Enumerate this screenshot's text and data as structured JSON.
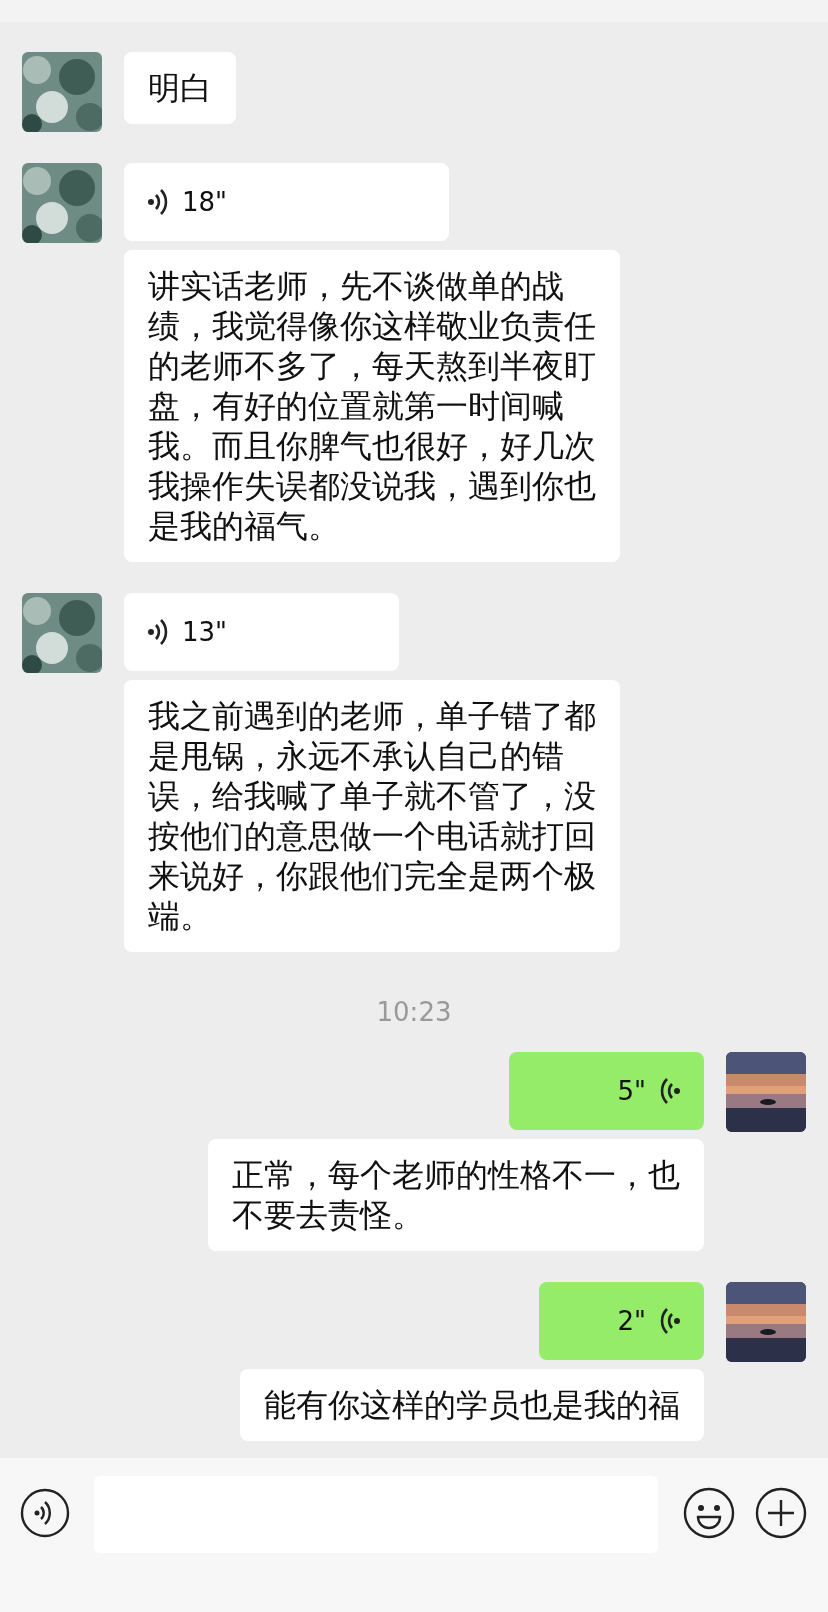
{
  "items": [
    {
      "kind": "group",
      "outgoing": false,
      "bubbles": [
        {
          "kind": "text",
          "lines": [
            "明白"
          ]
        }
      ]
    },
    {
      "kind": "group",
      "outgoing": false,
      "bubbles": [
        {
          "kind": "voice",
          "duration": "18\""
        },
        {
          "kind": "text",
          "lines": [
            "讲实话老师，先不谈做单的战",
            "绩，我觉得像你这样敬业负责任",
            "的老师不多了，每天熬到半夜盯",
            "盘，有好的位置就第一时间喊",
            "我。而且你脾气也很好，好几次",
            "我操作失误都没说我，遇到你也",
            "是我的福气。"
          ]
        }
      ]
    },
    {
      "kind": "group",
      "outgoing": false,
      "bubbles": [
        {
          "kind": "voice",
          "duration": "13\""
        },
        {
          "kind": "text",
          "lines": [
            "我之前遇到的老师，单子错了都",
            "是甩锅，永远不承认自己的错",
            "误，给我喊了单子就不管了，没",
            "按他们的意思做一个电话就打回",
            "来说好，你跟他们完全是两个极",
            "端。"
          ]
        }
      ]
    },
    {
      "kind": "time",
      "text": "10:23"
    },
    {
      "kind": "group",
      "outgoing": true,
      "bubbles": [
        {
          "kind": "voice",
          "duration": "5\""
        },
        {
          "kind": "text",
          "lines": [
            "正常，每个老师的性格不一，也",
            "不要去责怪。"
          ]
        }
      ]
    },
    {
      "kind": "group",
      "outgoing": true,
      "bubbles": [
        {
          "kind": "voice",
          "duration": "2\""
        },
        {
          "kind": "text",
          "lines": [
            "能有你这样的学员也是我的福"
          ]
        }
      ]
    }
  ]
}
